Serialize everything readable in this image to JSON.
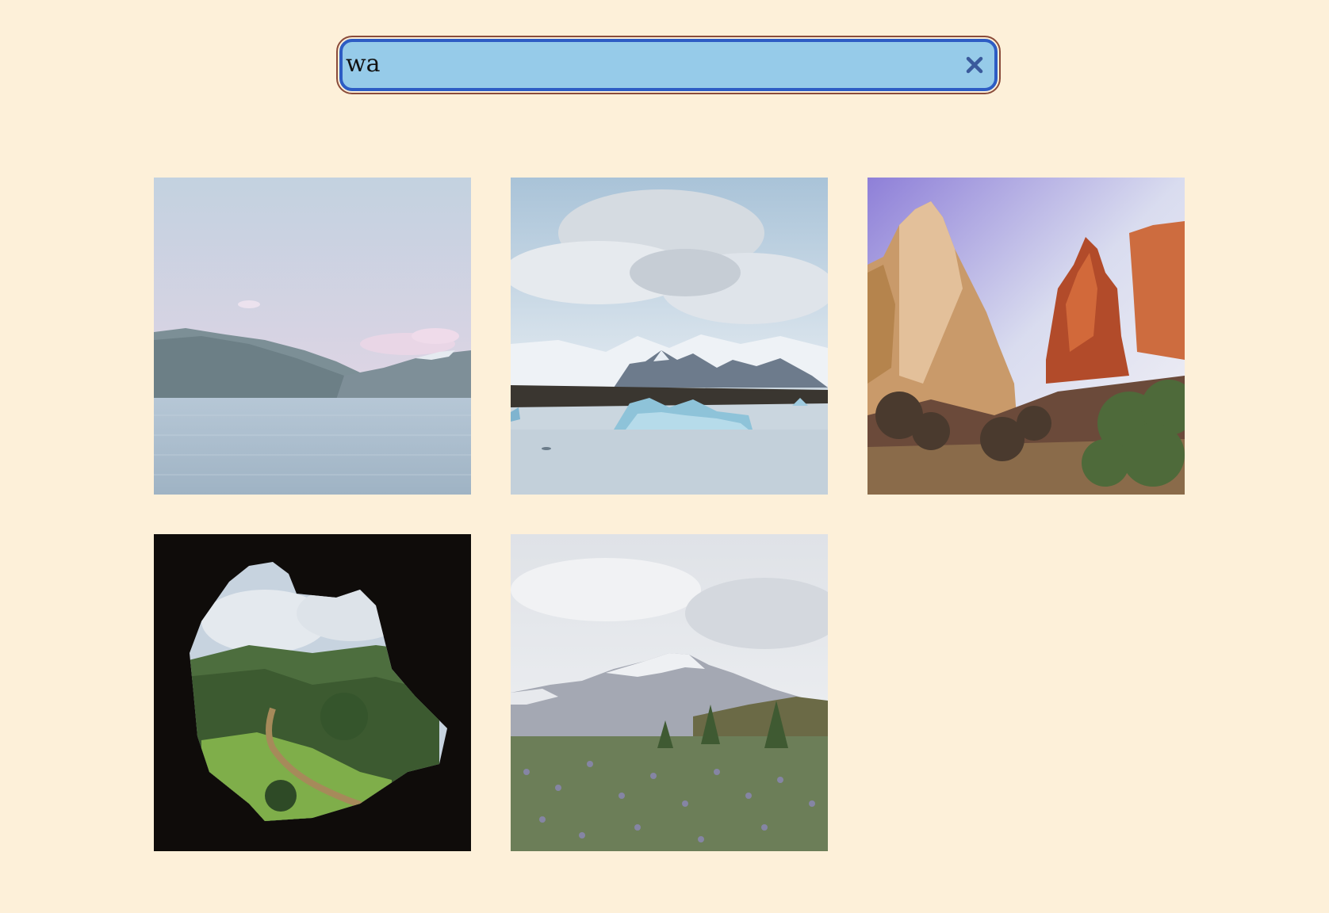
{
  "search": {
    "value": "wa",
    "clear_icon": "close-icon"
  },
  "colors": {
    "background": "#fdf0d9",
    "search_fill": "#96cbe9",
    "search_border": "#2d5cc4",
    "search_outer_border": "#8a4b3a",
    "clear_icon": "#3a5a9c"
  },
  "gallery": {
    "images": [
      {
        "subject": "lake-mountains-image"
      },
      {
        "subject": "glacier-lagoon-image"
      },
      {
        "subject": "red-rock-canyon-image"
      },
      {
        "subject": "cave-valley-view-image"
      },
      {
        "subject": "lupine-field-mountain-image"
      }
    ]
  }
}
